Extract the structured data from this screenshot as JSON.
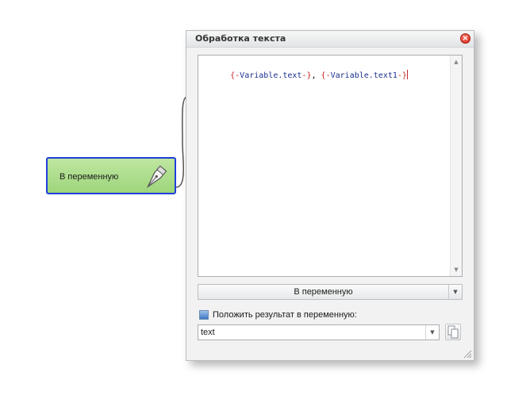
{
  "node": {
    "label": "В переменную",
    "icon": "pen-nib-icon",
    "color": "#a9dc88",
    "border_color": "#1f3fd8"
  },
  "dialog": {
    "title": "Обработка текста",
    "close_icon": "close-icon",
    "editor": {
      "tokens": [
        {
          "text": "{-",
          "role": "brace"
        },
        {
          "text": "Variable.text",
          "role": "text"
        },
        {
          "text": "-}",
          "role": "brace"
        },
        {
          "text": ", ",
          "role": "plain"
        },
        {
          "text": "{-",
          "role": "brace"
        },
        {
          "text": "Variable.text1",
          "role": "text"
        },
        {
          "text": "-}",
          "role": "brace"
        }
      ]
    },
    "mode_dropdown": {
      "value": "В переменную"
    },
    "save_checkbox": {
      "label": "Положить результат в переменную:",
      "checked": true
    },
    "variable_select": {
      "value": "text"
    },
    "copy_button_icon": "copy-icon"
  }
}
